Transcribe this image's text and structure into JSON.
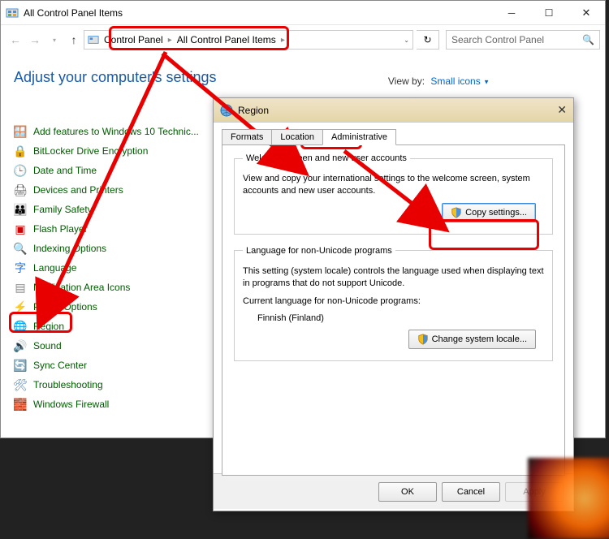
{
  "window": {
    "title": "All Control Panel Items"
  },
  "breadcrumb": {
    "part1": "Control Panel",
    "part2": "All Control Panel Items"
  },
  "search": {
    "placeholder": "Search Control Panel"
  },
  "heading": "Adjust your computer's settings",
  "viewby": {
    "label": "View by:",
    "value": "Small icons"
  },
  "items": [
    {
      "label": "Add features to Windows 10 Technic...",
      "icon": "🪟",
      "color": "#1a73e8"
    },
    {
      "label": "BitLocker Drive Encryption",
      "icon": "🔒",
      "color": "#888"
    },
    {
      "label": "Date and Time",
      "icon": "🕒",
      "color": "#1a8a1a"
    },
    {
      "label": "Devices and Printers",
      "icon": "🖨",
      "color": "#555"
    },
    {
      "label": "Family Safety",
      "icon": "👪",
      "color": "#d88a00"
    },
    {
      "label": "Flash Player",
      "icon": "▣",
      "color": "#c00"
    },
    {
      "label": "Indexing Options",
      "icon": "🔍",
      "color": "#1a73e8"
    },
    {
      "label": "Language",
      "icon": "字",
      "color": "#1a73e8"
    },
    {
      "label": "Notification Area Icons",
      "icon": "▤",
      "color": "#888"
    },
    {
      "label": "Power Options",
      "icon": "⚡",
      "color": "#2a9d2a"
    },
    {
      "label": "Region",
      "icon": "🌐",
      "color": "#1a73e8"
    },
    {
      "label": "Sound",
      "icon": "🔊",
      "color": "#888"
    },
    {
      "label": "Sync Center",
      "icon": "🔄",
      "color": "#1a8a1a"
    },
    {
      "label": "Troubleshooting",
      "icon": "🛠",
      "color": "#5a82b9"
    },
    {
      "label": "Windows Firewall",
      "icon": "🧱",
      "color": "#c06000"
    }
  ],
  "dialog": {
    "title": "Region",
    "tabs": [
      "Formats",
      "Location",
      "Administrative"
    ],
    "activeTab": 2,
    "group1": {
      "legend": "Welcome screen and new user accounts",
      "desc": "View and copy your international settings to the welcome screen, system accounts and new user accounts.",
      "button": "Copy settings..."
    },
    "group2": {
      "legend": "Language for non-Unicode programs",
      "desc": "This setting (system locale) controls the language used when displaying text in programs that do not support Unicode.",
      "current_label": "Current language for non-Unicode programs:",
      "current_value": "Finnish (Finland)",
      "button": "Change system locale..."
    },
    "footer": {
      "ok": "OK",
      "cancel": "Cancel",
      "apply": "Apply"
    }
  }
}
